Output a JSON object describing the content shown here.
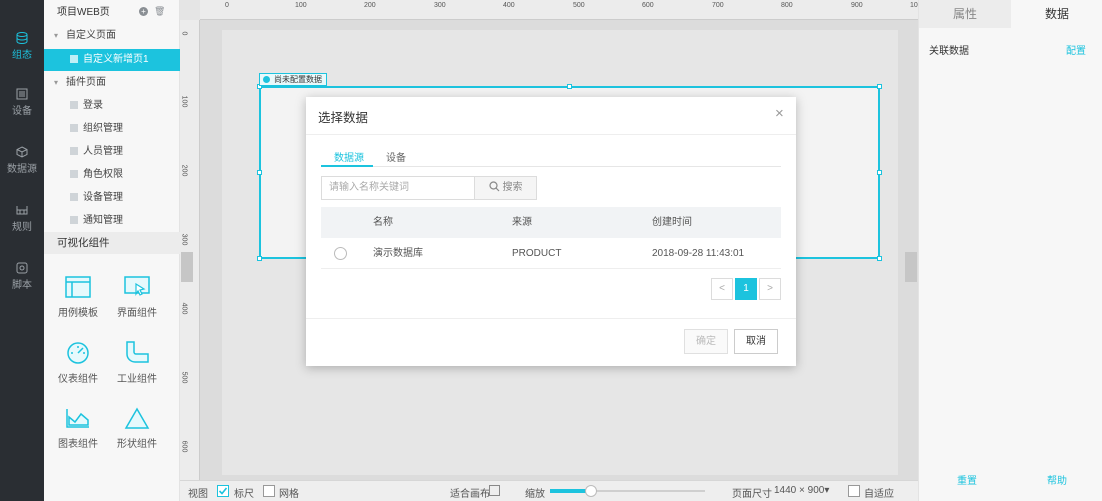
{
  "rail": [
    {
      "label": "组态",
      "icon": "database-icon",
      "active": true
    },
    {
      "label": "设备",
      "icon": "device-icon"
    },
    {
      "label": "数据源",
      "icon": "cube-icon"
    },
    {
      "label": "规则",
      "icon": "rule-icon"
    },
    {
      "label": "脚本",
      "icon": "script-icon"
    }
  ],
  "tree": {
    "project": "项目WEB页",
    "custom_group": "自定义页面",
    "custom_page": "自定义新增页1",
    "plugin_group": "插件页面",
    "plugin_pages": [
      "登录",
      "组织管理",
      "人员管理",
      "角色权限",
      "设备管理",
      "通知管理"
    ]
  },
  "components": {
    "header": "可视化组件",
    "items": [
      {
        "label": "用例模板",
        "icon": "template-icon"
      },
      {
        "label": "界面组件",
        "icon": "ui-component-icon"
      },
      {
        "label": "仪表组件",
        "icon": "gauge-icon"
      },
      {
        "label": "工业组件",
        "icon": "pipe-icon"
      },
      {
        "label": "图表组件",
        "icon": "chart-icon"
      },
      {
        "label": "形状组件",
        "icon": "triangle-icon"
      }
    ]
  },
  "ruler": {
    "top": [
      "0",
      "100",
      "200",
      "300",
      "400",
      "500",
      "600",
      "700",
      "800",
      "900",
      "10"
    ],
    "left": [
      "0",
      "100",
      "200",
      "300",
      "400",
      "500",
      "600"
    ]
  },
  "canvas": {
    "no_data_tag": "尚未配置数据"
  },
  "right_panel": {
    "tabs": [
      "属性",
      "数据"
    ],
    "related_label": "关联数据",
    "config_link": "配置",
    "reset": "重置",
    "help": "帮助"
  },
  "bottom": {
    "view": "视图",
    "ruler": "标尺",
    "grid": "网格",
    "fit": "适合画布",
    "zoom": "缩放",
    "page_size_label": "页面尺寸",
    "page_size_value": "1440 × 900▾",
    "adaptive": "自适应"
  },
  "dialog": {
    "title": "选择数据",
    "close": "×",
    "tabs": [
      "数据源",
      "设备"
    ],
    "search_placeholder": "请输入名称关键词",
    "search_button": "搜索",
    "columns": [
      "名称",
      "来源",
      "创建时间"
    ],
    "rows": [
      {
        "name": "演示数据库",
        "source": "PRODUCT",
        "created": "2018-09-28 11:43:01"
      }
    ],
    "page": "1",
    "prev": "<",
    "next": ">",
    "confirm": "确定",
    "cancel": "取消"
  },
  "colors": {
    "accent": "#1cc3de",
    "rail_bg": "#2a2e33"
  }
}
